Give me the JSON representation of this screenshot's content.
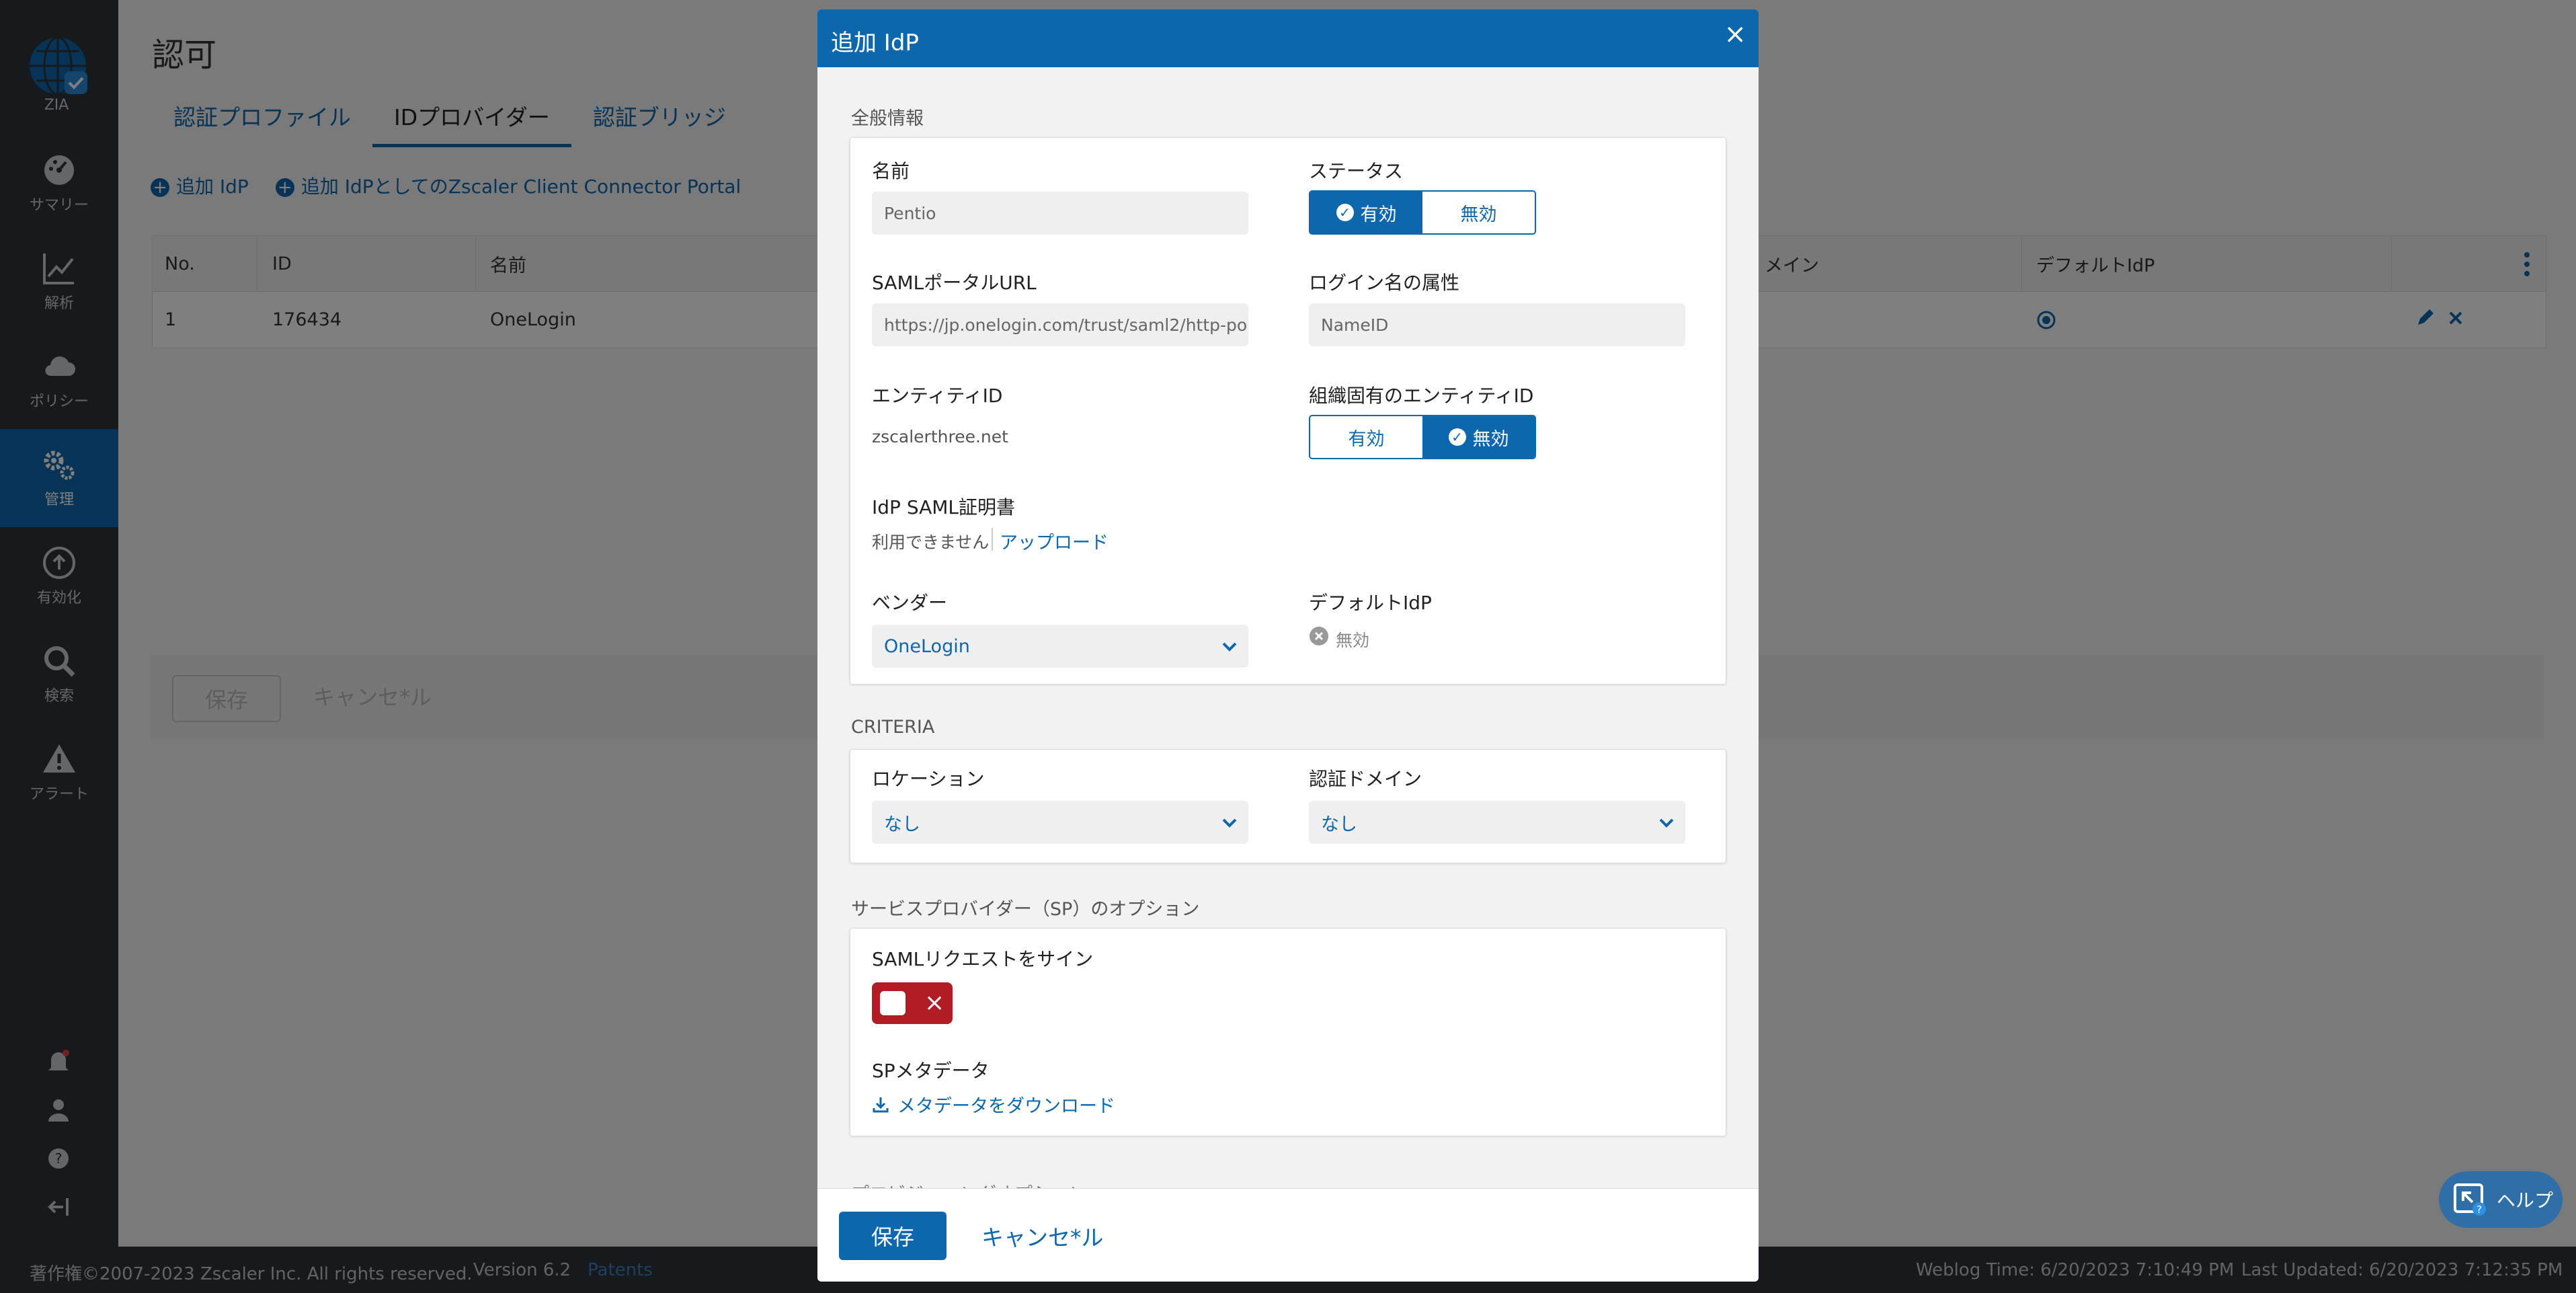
{
  "app": {
    "logo_label": "ZIA",
    "nav": [
      {
        "label": "サマリー",
        "icon": "dashboard-icon"
      },
      {
        "label": "解析",
        "icon": "chart-icon"
      },
      {
        "label": "ポリシー",
        "icon": "cloud-icon"
      },
      {
        "label": "管理",
        "icon": "gears-icon"
      },
      {
        "label": "有効化",
        "icon": "activate-icon"
      },
      {
        "label": "検索",
        "icon": "search-icon"
      },
      {
        "label": "アラート",
        "icon": "alert-icon"
      }
    ]
  },
  "page": {
    "title": "認可",
    "tabs": [
      "認証プロファイル",
      "IDプロバイダー",
      "認証ブリッジ"
    ],
    "actions": [
      "追加 IdP",
      "追加 IdPとしてのZscaler Client Connector Portal"
    ],
    "table": {
      "headers": [
        "No.",
        "ID",
        "名前",
        "メイン",
        "デフォルトIdP"
      ],
      "row": {
        "no": "1",
        "id": "176434",
        "name": "OneLogin"
      }
    },
    "save_label": "保存",
    "cancel_label": "キャンセ*ル"
  },
  "footer": {
    "copyright": "著作権©2007-2023 Zscaler Inc. All rights reserved.",
    "version": "Version 6.2",
    "patents": "Patents",
    "weblog": "Weblog Time: 6/20/2023 7:10:49 PM",
    "updated": "Last Updated: 6/20/2023 7:12:35 PM"
  },
  "modal": {
    "title": "追加 IdP",
    "general_section": "全般情報",
    "name_label": "名前",
    "name_value": "Pentio",
    "status_label": "ステータス",
    "status_on": "有効",
    "status_off": "無効",
    "saml_url_label": "SAMLポータルURL",
    "saml_url_value": "https://jp.onelogin.com/trust/saml2/http-po...",
    "login_attr_label": "ログイン名の属性",
    "login_attr_value": "NameID",
    "entity_id_label": "エンティティID",
    "entity_id_value": "zscalerthree.net",
    "org_entity_label": "組織固有のエンティティID",
    "org_on": "有効",
    "org_off": "無効",
    "cert_label": "IdP SAML証明書",
    "cert_unavailable": "利用できません",
    "cert_upload": "アップロード",
    "vendor_label": "ベンダー",
    "vendor_value": "OneLogin",
    "default_idp_label": "デフォルトIdP",
    "default_idp_value": "無効",
    "criteria_section": "CRITERIA",
    "location_label": "ロケーション",
    "location_value": "なし",
    "auth_domain_label": "認証ドメイン",
    "auth_domain_value": "なし",
    "sp_section": "サービスプロバイダー（SP）のオプション",
    "sign_saml_label": "SAMLリクエストをサイン",
    "sp_metadata_label": "SPメタデータ",
    "download_metadata": "メタデータをダウンロード",
    "provisioning_section": "プロビジョニングオプション",
    "save_button": "保存",
    "cancel_button": "キャンセ*ル"
  },
  "help": {
    "label": "ヘルプ"
  }
}
